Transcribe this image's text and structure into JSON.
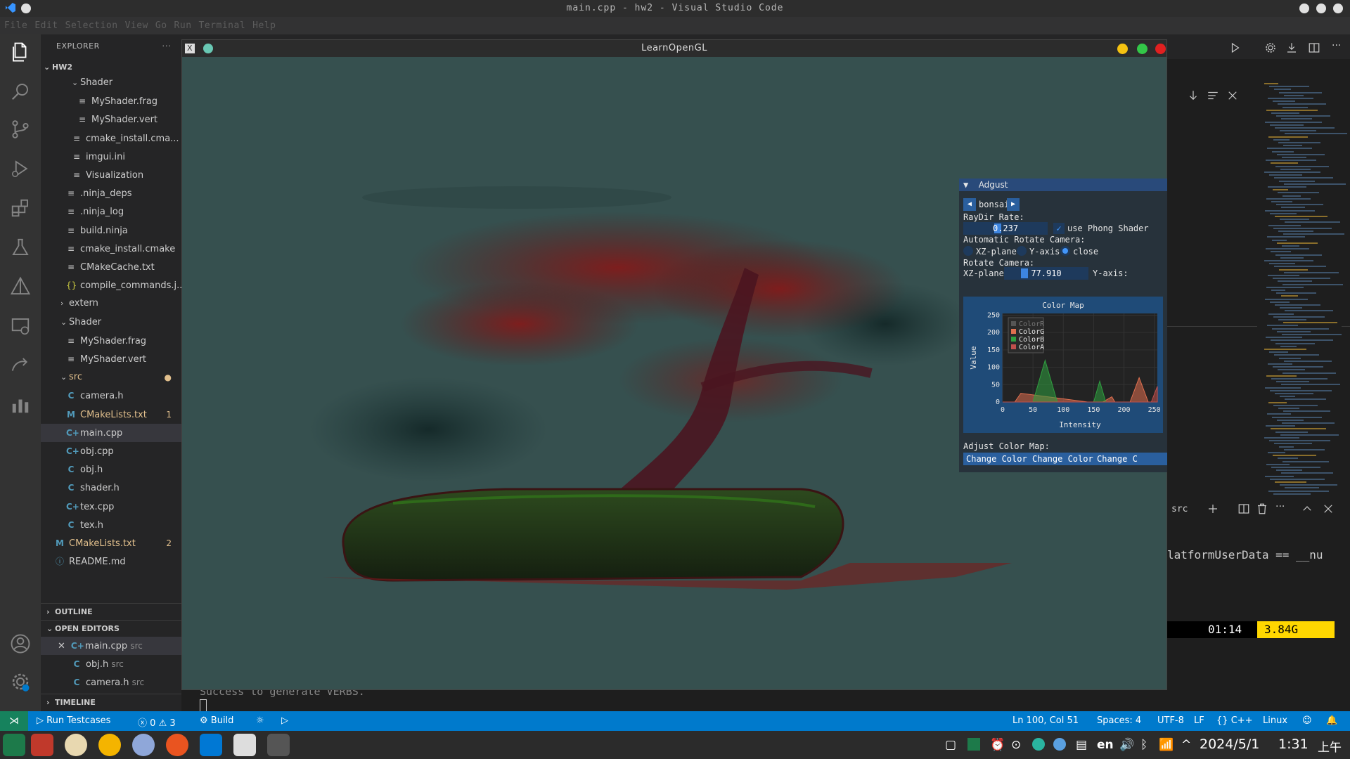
{
  "window": {
    "title": "main.cpp - hw2 - Visual Studio Code",
    "menu": [
      "File",
      "Edit",
      "Selection",
      "View",
      "Go",
      "Run",
      "Terminal",
      "Help"
    ]
  },
  "activity_icons": [
    "files-icon",
    "search-icon",
    "source-control-icon",
    "run-debug-icon",
    "extensions-icon",
    "testing-icon",
    "cmake-icon",
    "remote-explorer-icon",
    "live-share-icon",
    "chart-icon",
    "account-icon",
    "settings-gear-icon"
  ],
  "explorer": {
    "header": "EXPLORER",
    "more": "···",
    "root": "HW2",
    "rows": [
      {
        "label": "Shader",
        "kind": "folder-open",
        "indent": 2
      },
      {
        "label": "MyShader.frag",
        "kind": "file",
        "indent": 3
      },
      {
        "label": "MyShader.vert",
        "kind": "file",
        "indent": 3
      },
      {
        "label": "cmake_install.cma...",
        "kind": "file",
        "indent": 2
      },
      {
        "label": "imgui.ini",
        "kind": "file",
        "indent": 2
      },
      {
        "label": "Visualization",
        "kind": "file",
        "indent": 2
      },
      {
        "label": ".ninja_deps",
        "kind": "file",
        "indent": 1
      },
      {
        "label": ".ninja_log",
        "kind": "file",
        "indent": 1
      },
      {
        "label": "build.ninja",
        "kind": "file",
        "indent": 1
      },
      {
        "label": "cmake_install.cmake",
        "kind": "file",
        "indent": 1
      },
      {
        "label": "CMakeCache.txt",
        "kind": "file",
        "indent": 1
      },
      {
        "label": "compile_commands.j...",
        "kind": "json",
        "indent": 1
      },
      {
        "label": "extern",
        "kind": "folder-closed",
        "indent": 0
      },
      {
        "label": "Shader",
        "kind": "folder-open",
        "indent": 0
      },
      {
        "label": "MyShader.frag",
        "kind": "file",
        "indent": 1
      },
      {
        "label": "MyShader.vert",
        "kind": "file",
        "indent": 1
      },
      {
        "label": "src",
        "kind": "folder-open-mod",
        "indent": 0
      },
      {
        "label": "camera.h",
        "kind": "c",
        "indent": 1
      },
      {
        "label": "CMakeLists.txt",
        "kind": "m-mod",
        "indent": 1,
        "badge": "1"
      },
      {
        "label": "main.cpp",
        "kind": "cpp",
        "indent": 1,
        "selected": true
      },
      {
        "label": "obj.cpp",
        "kind": "cpp",
        "indent": 1
      },
      {
        "label": "obj.h",
        "kind": "c",
        "indent": 1
      },
      {
        "label": "shader.h",
        "kind": "c",
        "indent": 1
      },
      {
        "label": "tex.cpp",
        "kind": "cpp",
        "indent": 1
      },
      {
        "label": "tex.h",
        "kind": "c",
        "indent": 1
      },
      {
        "label": "CMakeLists.txt",
        "kind": "m-mod",
        "indent": -1,
        "badge": "2"
      },
      {
        "label": "README.md",
        "kind": "info",
        "indent": -1
      }
    ],
    "outline": "OUTLINE",
    "open_editors": "OPEN EDITORS",
    "open_files": [
      {
        "name": "main.cpp",
        "dir": "src",
        "kind": "cpp"
      },
      {
        "name": "obj.h",
        "dir": "src",
        "kind": "c"
      },
      {
        "name": "camera.h",
        "dir": "src",
        "kind": "c"
      }
    ],
    "timeline": "TIMELINE"
  },
  "terminal": {
    "line1": "Success to generate VERBS.",
    "right_line": "latformUserData == __nu",
    "prompt_dir": "src",
    "clock": "01:14",
    "mem": "3.84G"
  },
  "gl_window": {
    "title": "LearnOpenGL",
    "scene_colors": {
      "bg": "#36504f",
      "red": "#8b1a1a",
      "green": "#1e5a1e"
    }
  },
  "imgui": {
    "panel_title": "Adgust",
    "dataset": "bonsai",
    "raydir_label": "RayDir Rate:",
    "raydir_value": "0.237",
    "phong_label": "use Phong Shader",
    "auto_rotate_label": "Automatic Rotate Camera:",
    "radio": [
      "XZ-plane",
      "Y-axis",
      "close"
    ],
    "rotate_label": "Rotate Camera:",
    "xz_label": "XZ-plane:",
    "xz_value": "77.910",
    "y_label": "Y-axis:",
    "adjust_label": "Adjust Color Map:",
    "buttons": [
      "Change Color R",
      "Change Color G",
      "Change C"
    ]
  },
  "chart_data": {
    "type": "area",
    "title": "Color Map",
    "xlabel": "Intensity",
    "ylabel": "Value",
    "xlim": [
      0,
      255
    ],
    "ylim": [
      0,
      255
    ],
    "xticks": [
      0,
      50,
      100,
      150,
      200,
      250
    ],
    "yticks": [
      0,
      50,
      100,
      150,
      200,
      250
    ],
    "legend": [
      "ColorR",
      "ColorG",
      "ColorB",
      "ColorA"
    ],
    "legend_position": "top-left",
    "series": [
      {
        "name": "ColorR",
        "color": "#555555",
        "x": [
          0,
          255
        ],
        "y": [
          0,
          0
        ]
      },
      {
        "name": "ColorG",
        "color": "#e07050",
        "x": [
          0,
          20,
          30,
          140,
          150,
          165,
          180,
          185,
          210,
          225,
          240,
          255
        ],
        "y": [
          0,
          0,
          25,
          0,
          0,
          0,
          15,
          0,
          0,
          70,
          0,
          0
        ]
      },
      {
        "name": "ColorB",
        "color": "#2fa040",
        "x": [
          0,
          50,
          70,
          90,
          140,
          150,
          160,
          170,
          255
        ],
        "y": [
          0,
          0,
          120,
          0,
          0,
          0,
          60,
          0,
          0
        ]
      },
      {
        "name": "ColorA",
        "color": "#c0504d",
        "x": [
          0,
          140,
          160,
          185,
          235,
          245,
          255
        ],
        "y": [
          0,
          0,
          0,
          0,
          0,
          0,
          45
        ]
      }
    ]
  },
  "statusbar": {
    "run_tests": "Run Testcases",
    "errors": "0",
    "warnings": "3",
    "build": "Build",
    "position": "Ln 100, Col 51",
    "spaces": "Spaces: 4",
    "encoding": "UTF-8",
    "eol": "LF",
    "lang": "C++",
    "platform": "Linux"
  },
  "taskbar": {
    "lang": "en",
    "date": "2024/5/1",
    "time": "1:31",
    "ampm": "上午"
  }
}
